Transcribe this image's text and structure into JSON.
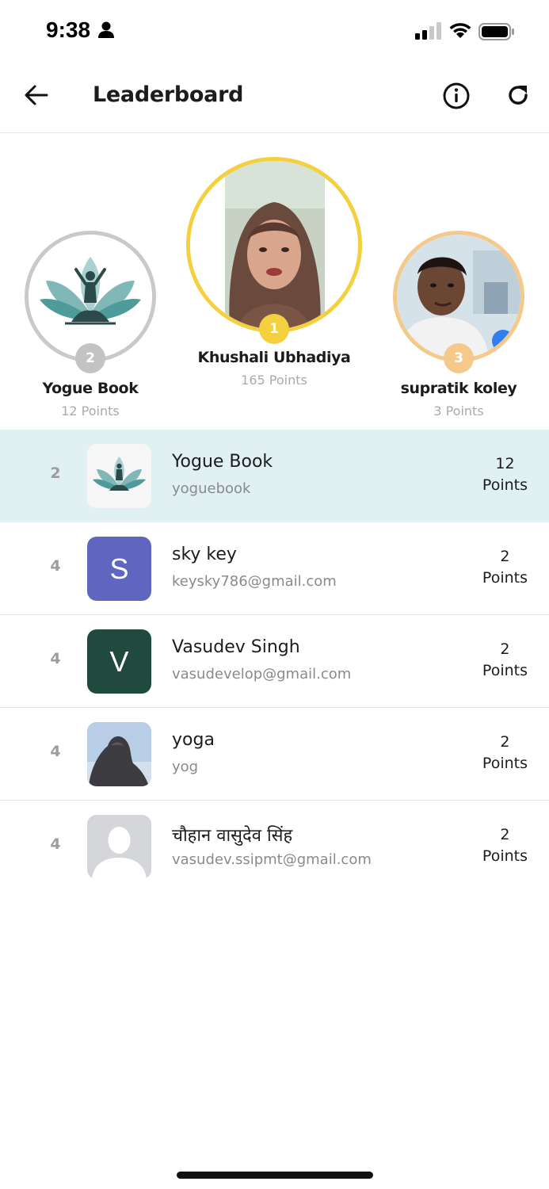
{
  "status_bar": {
    "time": "9:38"
  },
  "header": {
    "title": "Leaderboard"
  },
  "podium": {
    "first": {
      "rank": "1",
      "name": "Khushali Ubhadiya",
      "points": "165 Points"
    },
    "second": {
      "rank": "2",
      "name": "Yogue Book",
      "points": "12 Points"
    },
    "third": {
      "rank": "3",
      "name": "supratik koley",
      "points": "3 Points"
    }
  },
  "list": [
    {
      "rank": "2",
      "name": "Yogue Book",
      "sub": "yoguebook",
      "points_value": "12",
      "points_label": "Points",
      "avatar": "lotus-logo",
      "highlight": true
    },
    {
      "rank": "4",
      "name": "sky key",
      "sub": "keysky786@gmail.com",
      "points_value": "2",
      "points_label": "Points",
      "avatar_letter": "S",
      "avatar_color": "#5f66c0"
    },
    {
      "rank": "4",
      "name": "Vasudev Singh",
      "sub": "vasudevelop@gmail.com",
      "points_value": "2",
      "points_label": "Points",
      "avatar_letter": "V",
      "avatar_color": "#1f4a3d"
    },
    {
      "rank": "4",
      "name": "yoga",
      "sub": "yog",
      "points_value": "2",
      "points_label": "Points",
      "avatar": "statue-photo"
    },
    {
      "rank": "4",
      "name": "चौहान वासुदेव सिंह",
      "sub": "vasudev.ssipmt@gmail.com",
      "points_value": "2",
      "points_label": "Points",
      "avatar": "default-person"
    }
  ],
  "colors": {
    "gold": "#f4d03f",
    "silver": "#c3c3c3",
    "bronze": "#f5c98a",
    "highlight_row": "#e0f0f3",
    "lotus": "#4f9a9a"
  }
}
